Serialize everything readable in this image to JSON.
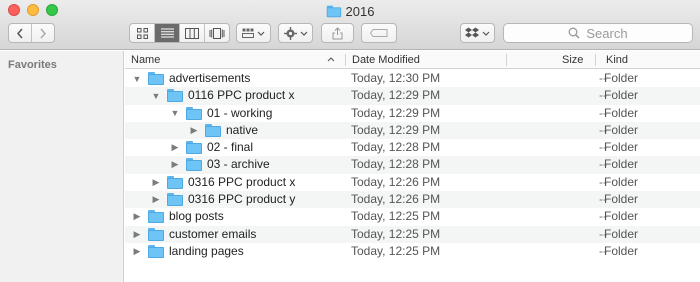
{
  "window": {
    "title": "2016"
  },
  "toolbar": {
    "search_placeholder": "Search"
  },
  "sidebar": {
    "section_title": "Favorites"
  },
  "columns": {
    "name": "Name",
    "date": "Date Modified",
    "size": "Size",
    "kind": "Kind"
  },
  "rows": [
    {
      "name": "advertisements",
      "date": "Today, 12:30 PM",
      "size": "--",
      "kind": "Folder",
      "level": 0,
      "expanded": true
    },
    {
      "name": "0116 PPC product x",
      "date": "Today, 12:29 PM",
      "size": "--",
      "kind": "Folder",
      "level": 1,
      "expanded": true
    },
    {
      "name": "01 - working",
      "date": "Today, 12:29 PM",
      "size": "--",
      "kind": "Folder",
      "level": 2,
      "expanded": true
    },
    {
      "name": "native",
      "date": "Today, 12:29 PM",
      "size": "--",
      "kind": "Folder",
      "level": 3,
      "expanded": false
    },
    {
      "name": "02 - final",
      "date": "Today, 12:28 PM",
      "size": "--",
      "kind": "Folder",
      "level": 2,
      "expanded": false
    },
    {
      "name": "03 - archive",
      "date": "Today, 12:28 PM",
      "size": "--",
      "kind": "Folder",
      "level": 2,
      "expanded": false
    },
    {
      "name": "0316 PPC product x",
      "date": "Today, 12:26 PM",
      "size": "--",
      "kind": "Folder",
      "level": 1,
      "expanded": false
    },
    {
      "name": "0316 PPC product y",
      "date": "Today, 12:26 PM",
      "size": "--",
      "kind": "Folder",
      "level": 1,
      "expanded": false
    },
    {
      "name": "blog posts",
      "date": "Today, 12:25 PM",
      "size": "--",
      "kind": "Folder",
      "level": 0,
      "expanded": false
    },
    {
      "name": "customer emails",
      "date": "Today, 12:25 PM",
      "size": "--",
      "kind": "Folder",
      "level": 0,
      "expanded": false
    },
    {
      "name": "landing pages",
      "date": "Today, 12:25 PM",
      "size": "--",
      "kind": "Folder",
      "level": 0,
      "expanded": false
    }
  ]
}
